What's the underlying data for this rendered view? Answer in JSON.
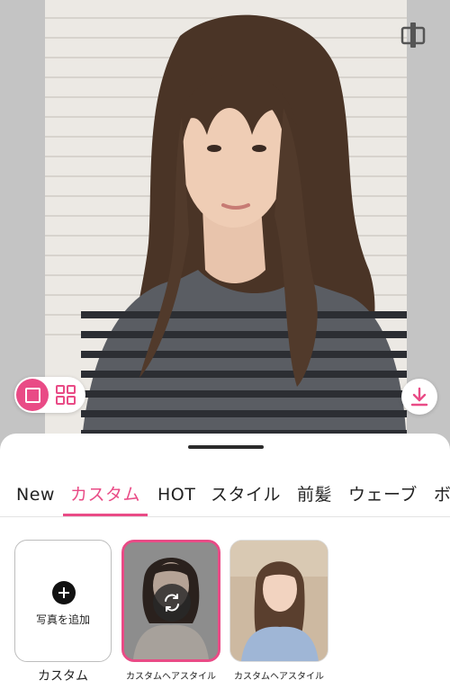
{
  "tabs": [
    {
      "label": "New"
    },
    {
      "label": "カスタム",
      "active": true
    },
    {
      "label": "HOT"
    },
    {
      "label": "スタイル"
    },
    {
      "label": "前髪"
    },
    {
      "label": "ウェーブ"
    },
    {
      "label": "ボ"
    }
  ],
  "tiles": {
    "add": {
      "label": "写真を追加",
      "caption": "カスタム"
    },
    "style1": {
      "caption": "カスタムヘアスタイル",
      "selected": true
    },
    "style2": {
      "caption": "カスタムヘアスタイル",
      "selected": false
    }
  },
  "colors": {
    "accent": "#e94b86",
    "preview_bg": "#c4c4c4"
  },
  "icons": {
    "compare": "compare-split-icon",
    "view_single": "single-view-icon",
    "view_grid": "grid-view-icon",
    "download": "download-icon",
    "add": "plus-icon",
    "regenerate": "refresh-icon"
  }
}
